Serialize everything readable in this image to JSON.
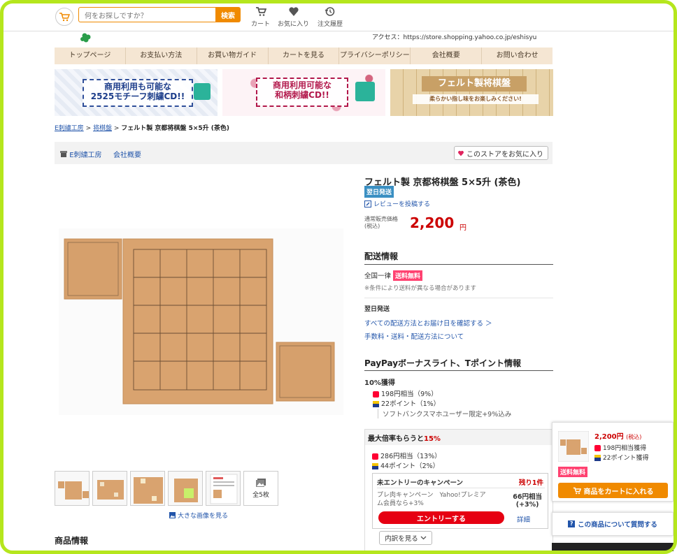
{
  "header": {
    "search_placeholder": "何をお探しですか？",
    "search_button": "検索",
    "nav": [
      {
        "label": "カート",
        "icon": "cart-icon"
      },
      {
        "label": "お気に入り",
        "icon": "heart-icon"
      },
      {
        "label": "注文履歴",
        "icon": "history-icon"
      }
    ],
    "access_text": "アクセス：https://store.shopping.yahoo.co.jp/eshisyu"
  },
  "store_nav": [
    "トップページ",
    "お支払い方法",
    "お買い物ガイド",
    "カートを見る",
    "プライバシーポリシー",
    "会社概要",
    "お問い合わせ"
  ],
  "banners": [
    {
      "line1": "商用利用も可能な",
      "line2": "2525モチーフ刺繍CD!!"
    },
    {
      "line1": "商用利用可能な",
      "line2": "和柄刺繍CD!!"
    },
    {
      "line1": "フェルト製将棋盤",
      "line2": "柔らかい指し味をお楽しみください!"
    }
  ],
  "breadcrumb": {
    "items": [
      "E刺繍工房",
      "将棋盤"
    ],
    "separator": ">",
    "current": "フェルト製 京都将棋盤 5×5升 (茶色)"
  },
  "store_bar": {
    "store_name": "E刺繍工房",
    "company": "会社概要",
    "favorite_button": "このストアをお気に入り"
  },
  "gallery": {
    "more_label": "全5枚",
    "big_image_link": "大きな画像を見る"
  },
  "product": {
    "title": "フェルト製 京都将棋盤 5×5升 (茶色)",
    "badge": "翌日発送",
    "review_link": "レビューを投稿する",
    "price_label_1": "通常販売価格",
    "price_label_2": "(税込)",
    "price": "2,200",
    "currency": "円"
  },
  "shipping": {
    "heading": "配送情報",
    "nationwide": "全国一律",
    "free_badge": "送料無料",
    "note": "※条件により送料が異なる場合があります",
    "next_day_heading": "翌日発送",
    "check_link": "すべての配送方法とお届け日を確認する ＞",
    "fees_link": "手数料・送料・配送方法について"
  },
  "points": {
    "heading": "PayPayボーナスライト、Tポイント情報",
    "rate": "10%獲得",
    "paypay": "198円相当（9%）",
    "tpoint": "22ポイント（1%）",
    "softbank": "ソフトバンクスマホユーザー限定+9%込み",
    "max_heading_prefix": "最大倍率もらうと",
    "max_rate": "15%",
    "max_paypay": "286円相当（13%）",
    "max_tpoint": "44ポイント（2%）",
    "campaign_title": "未エントリーのキャンペーン",
    "remaining": "残り1件",
    "campaign_desc": "プレ肉キャンペーン　Yahoo!プレミアム会員なら+3%",
    "campaign_amount": "66円相当",
    "campaign_rate": "(+3%)",
    "entry_button": "エントリーする",
    "detail_link": "詳細",
    "breakdown_button": "内訳を見る"
  },
  "section_heading": "商品情報",
  "float_panel": {
    "price": "2,200円",
    "tax": "(税込)",
    "paypay": "198円相当獲得",
    "tpoint": "22ポイント獲得",
    "free_badge": "送料無料",
    "cart_button": "商品をカートに入れる",
    "question_button": "この商品について質問する"
  },
  "colors": {
    "accent_orange": "#f08a00",
    "price_red": "#cc0000",
    "link_blue": "#2255aa",
    "frame_green": "#b5e61d",
    "felt_brown": "#d9a06a"
  }
}
